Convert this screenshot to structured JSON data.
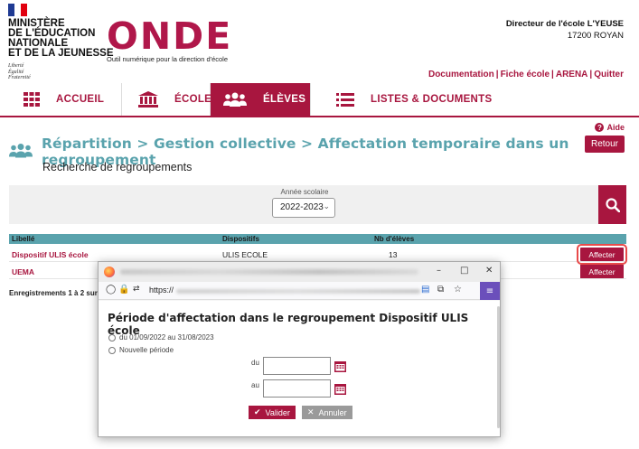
{
  "header": {
    "ministry_lines": [
      "MINISTÈRE",
      "DE L'ÉDUCATION",
      "NATIONALE",
      "ET DE LA JEUNESSE"
    ],
    "devise_lines": [
      "Liberté",
      "Égalité",
      "Fraternité"
    ],
    "logo": "ONDE",
    "tagline": "Outil numérique pour la direction d'école",
    "user_title": "Directeur de l'école L'YEUSE",
    "user_location": "17200 ROYAN",
    "links": [
      "Documentation",
      "Fiche école",
      "ARENA",
      "Quitter"
    ],
    "colors": {
      "brand": "#a8163f",
      "accent": "#5aa3ad"
    }
  },
  "nav": {
    "items": [
      {
        "label": "ACCUEIL",
        "icon": "grid-icon"
      },
      {
        "label": "ÉCOLE",
        "icon": "building-icon"
      },
      {
        "label": "ÉLÈVES",
        "icon": "people-icon",
        "active": true
      },
      {
        "label": "LISTES & DOCUMENTS",
        "icon": "list-icon"
      }
    ]
  },
  "page": {
    "title": "Répartition > Gestion collective > Affectation temporaire dans un regroupement",
    "subtitle": "Recherche de regroupements",
    "help": "Aide",
    "back": "Retour"
  },
  "search": {
    "year_label": "Année scolaire",
    "year_value": "2022-2023"
  },
  "table": {
    "headers": [
      "Libellé",
      "Dispositifs",
      "Nb d'élèves"
    ],
    "rows": [
      {
        "libelle": "Dispositif ULIS école",
        "dispositif": "ULIS ECOLE",
        "nb": "13",
        "action": "Affecter"
      },
      {
        "libelle": "UEMA",
        "dispositif": "",
        "nb": "",
        "action": "Affecter"
      }
    ],
    "records": "Enregistrements 1 à 2 sur"
  },
  "popup": {
    "url_prefix": "https://",
    "heading": "Période d'affectation dans le regroupement Dispositif ULIS école",
    "option1": "du 01/09/2022 au 31/08/2023",
    "option2": "Nouvelle période",
    "from_label": "du",
    "to_label": "au",
    "validate": "Valider",
    "cancel": "Annuler"
  }
}
